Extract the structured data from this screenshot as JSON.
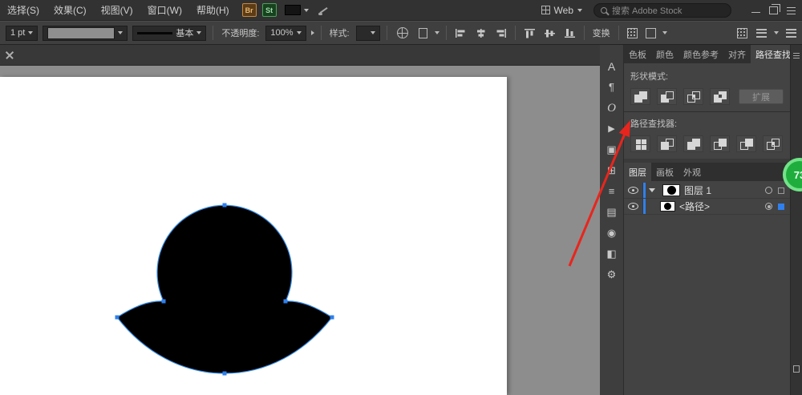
{
  "menubar": {
    "items": [
      {
        "label": "选择(S)"
      },
      {
        "label": "效果(C)"
      },
      {
        "label": "视图(V)"
      },
      {
        "label": "窗口(W)"
      },
      {
        "label": "帮助(H)"
      }
    ],
    "br_badge": "Br",
    "st_badge": "St",
    "workspace": "Web",
    "search_placeholder": "搜索 Adobe Stock"
  },
  "controlbar": {
    "stroke_weight": "1 pt",
    "brush_name": "基本",
    "opacity_label": "不透明度:",
    "opacity_value": "100%",
    "style_label": "样式:",
    "transform_label": "变换"
  },
  "tool_strip": [
    {
      "name": "character-panel-icon",
      "glyph": "A"
    },
    {
      "name": "paragraph-panel-icon",
      "glyph": "¶"
    },
    {
      "name": "opentype-panel-icon",
      "glyph": "O"
    },
    {
      "name": "libraries-panel-icon",
      "glyph": "▶"
    },
    {
      "name": "artboards-panel-icon",
      "glyph": "▣"
    },
    {
      "name": "transform-panel-icon",
      "glyph": "⊞"
    },
    {
      "name": "stroke-panel-icon",
      "glyph": "≡"
    },
    {
      "name": "gradient-panel-icon",
      "glyph": "▤"
    },
    {
      "name": "transparency-panel-icon",
      "glyph": "◉"
    },
    {
      "name": "symbols-panel-icon",
      "glyph": "◧"
    },
    {
      "name": "actions-panel-icon",
      "glyph": "⚙"
    }
  ],
  "panel_group": {
    "tabs": [
      {
        "label": "色板"
      },
      {
        "label": "颜色"
      },
      {
        "label": "颜色参考"
      },
      {
        "label": "对齐"
      },
      {
        "label": "路径查找器"
      }
    ]
  },
  "pathfinder": {
    "shape_modes_label": "形状模式:",
    "expand_button": "扩展",
    "pathfinders_label": "路径查找器:"
  },
  "layers_panel": {
    "tabs": [
      {
        "label": "图层"
      },
      {
        "label": "画板"
      },
      {
        "label": "外观"
      }
    ],
    "rows": [
      {
        "label": "图层 1"
      },
      {
        "label": "<路径>"
      }
    ]
  },
  "overlay": {
    "badge_value": "73"
  },
  "colors": {
    "selection_blue": "#2f80ed",
    "path_outline_blue": "#3a8ee6",
    "arrow_red": "#e8251d",
    "badge_green": "#1fae3d"
  }
}
